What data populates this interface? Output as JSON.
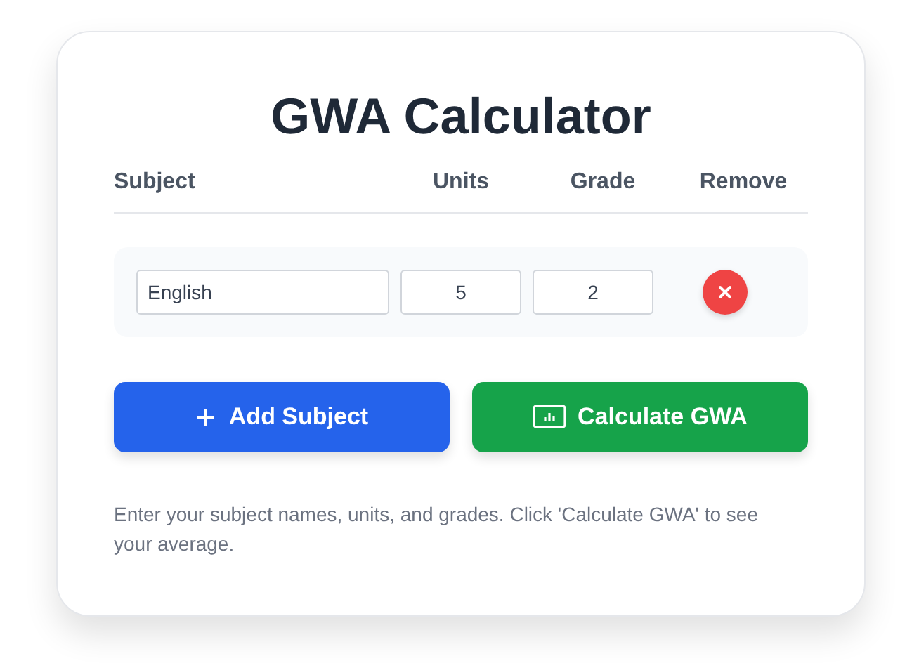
{
  "title": "GWA Calculator",
  "columns": [
    "Subject",
    "Units",
    "Grade",
    "Remove"
  ],
  "subjects": [
    {
      "name": "English",
      "units": "5",
      "grade": "2"
    }
  ],
  "buttons": [
    {
      "kind": "add",
      "label": "Add Subject"
    },
    {
      "kind": "calculate",
      "label": "Calculate GWA"
    }
  ],
  "help": "Enter your subject names, units, and grades. Click 'Calculate GWA' to see your average."
}
